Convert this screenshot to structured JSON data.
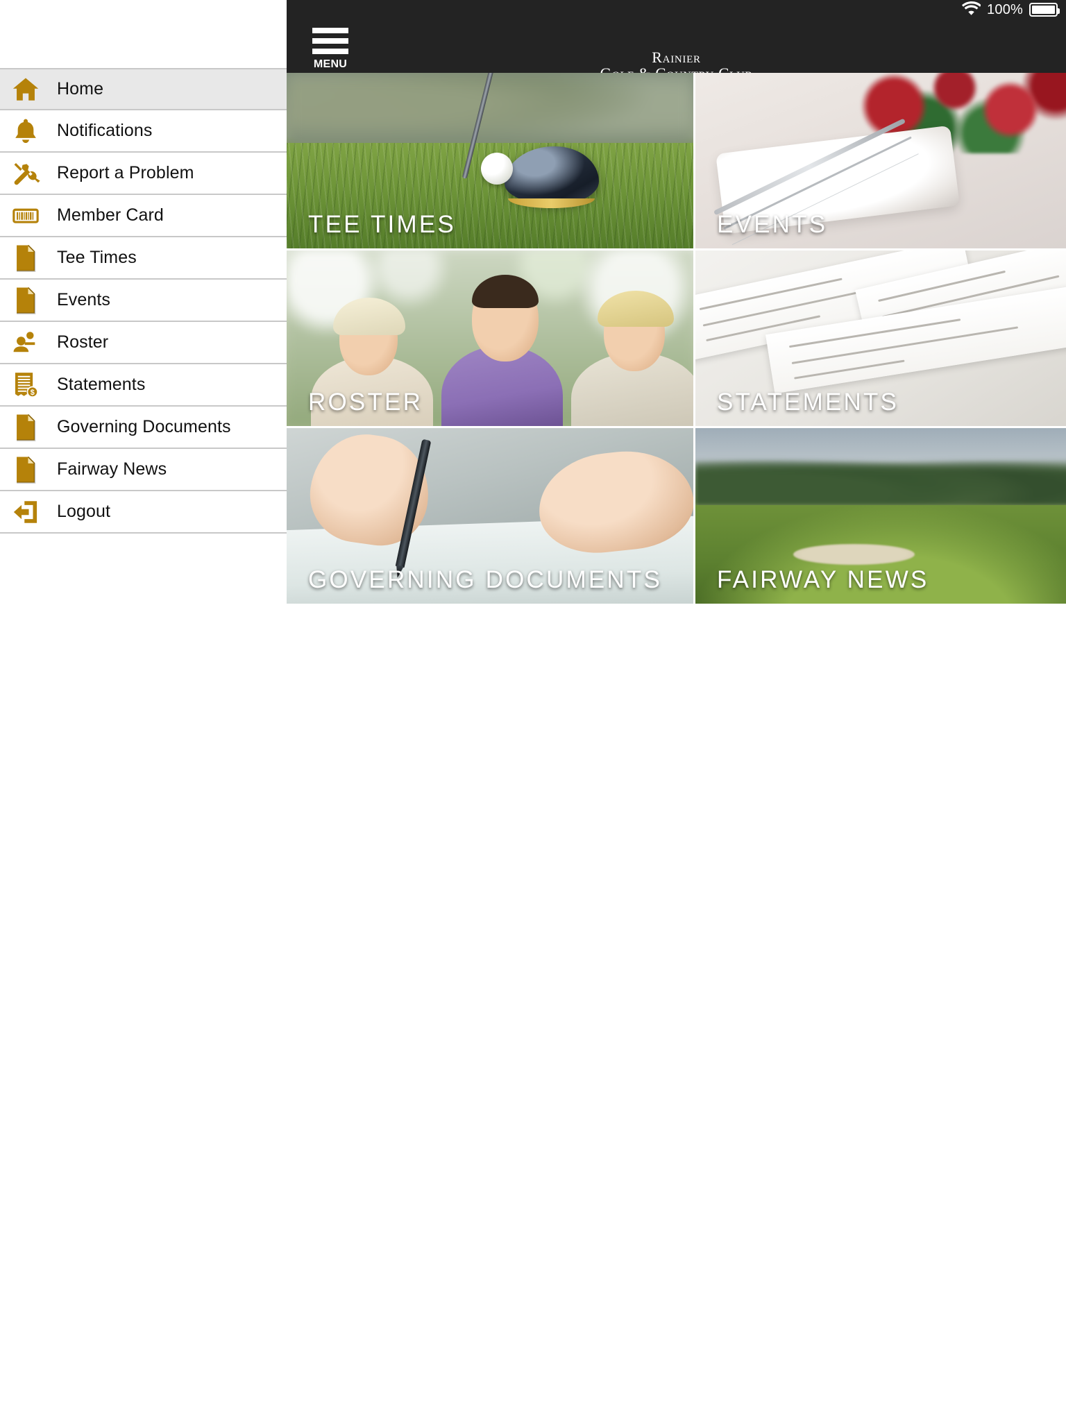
{
  "statusbar": {
    "wifi_icon": "wifi-icon",
    "battery_percent": "100%",
    "battery_icon": "battery-full-icon"
  },
  "header": {
    "menu_button_label": "MENU",
    "menu_icon": "hamburger-menu-icon",
    "logo_line1": "Rainier",
    "logo_line2": "Golf & Country Club",
    "background_color": "#232323"
  },
  "theme": {
    "accent_gold": "#b8860b",
    "icon_gold": "#b5820a",
    "active_row_bg": "#e8e8e8",
    "divider": "#c8c8c8",
    "text": "#111111"
  },
  "sidebar": {
    "items": [
      {
        "label": "Home",
        "icon": "home-icon",
        "active": true
      },
      {
        "label": "Notifications",
        "icon": "bell-icon",
        "active": false
      },
      {
        "label": "Report a Problem",
        "icon": "tools-icon",
        "active": false
      },
      {
        "label": "Member Card",
        "icon": "barcode-card-icon",
        "active": false
      },
      {
        "label": "Tee Times",
        "icon": "document-icon",
        "active": false
      },
      {
        "label": "Events",
        "icon": "document-icon",
        "active": false
      },
      {
        "label": "Roster",
        "icon": "people-icon",
        "active": false
      },
      {
        "label": "Statements",
        "icon": "invoice-dollar-icon",
        "active": false
      },
      {
        "label": "Governing Documents",
        "icon": "document-icon",
        "active": false
      },
      {
        "label": "Fairway News",
        "icon": "document-icon",
        "active": false
      },
      {
        "label": "Logout",
        "icon": "logout-arrow-icon",
        "active": false
      }
    ]
  },
  "main": {
    "tiles": [
      {
        "label": "TEE TIMES",
        "photo": "golf-driver-and-ball-on-grass"
      },
      {
        "label": "EVENTS",
        "photo": "table-setting-with-red-roses"
      },
      {
        "label": "ROSTER",
        "photo": "three-smiling-golfers"
      },
      {
        "label": "STATEMENTS",
        "photo": "billing-statement-slips"
      },
      {
        "label": "GOVERNING DOCUMENTS",
        "photo": "hand-signing-document-with-pen"
      },
      {
        "label": "FAIRWAY NEWS",
        "photo": "golf-course-fairway"
      }
    ]
  }
}
